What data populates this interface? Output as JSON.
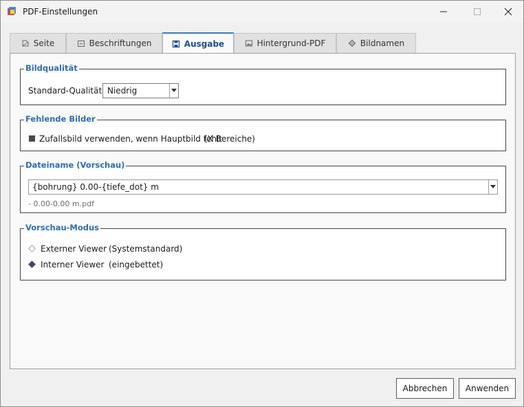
{
  "window": {
    "title": "PDF-Einstellungen"
  },
  "tabs": [
    {
      "label": "Seite",
      "icon": "page-icon",
      "active": false
    },
    {
      "label": "Beschriftungen",
      "icon": "label-icon",
      "active": false
    },
    {
      "label": "Ausgabe",
      "icon": "save-icon",
      "active": true
    },
    {
      "label": "Hintergrund-PDF",
      "icon": "image-icon",
      "active": false
    },
    {
      "label": "Bildnamen",
      "icon": "gear-icon",
      "active": false
    }
  ],
  "bildqualitaet": {
    "title": "Bildqualität",
    "label": "Standard-Qualität:",
    "selected": "Niedrig"
  },
  "fehlende_bilder": {
    "title": "Fehlende Bilder",
    "checkbox_label": "Zufallsbild verwenden, wenn Hauptbild fehlt",
    "checkbox_hint": "(X Bereiche)",
    "checked": true
  },
  "dateiname": {
    "title": "Dateiname (Vorschau)",
    "value": "{bohrung} 0.00-{tiefe_dot} m",
    "preview": "- 0.00-0.00 m.pdf"
  },
  "vorschau": {
    "title": "Vorschau-Modus",
    "options": [
      {
        "label": "Externer Viewer",
        "hint": "(Systemstandard)",
        "selected": false
      },
      {
        "label": "Interner Viewer",
        "hint": "(eingebettet)",
        "selected": true
      }
    ]
  },
  "buttons": {
    "cancel": "Abbrechen",
    "apply": "Anwenden"
  },
  "colors": {
    "accent": "#2e6fab",
    "tab_active_border": "#3b79c3"
  }
}
